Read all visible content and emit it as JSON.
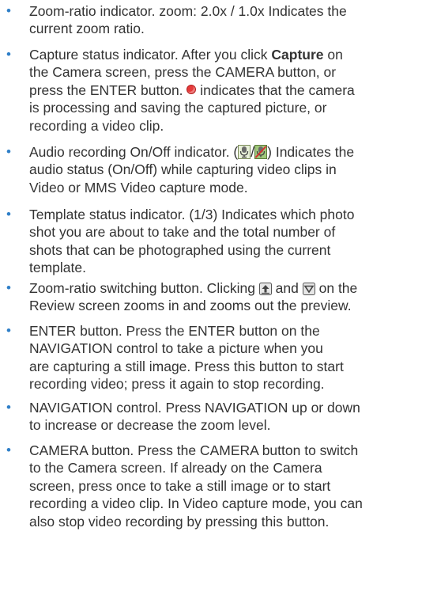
{
  "items": [
    {
      "lines": [
        "Zoom-ratio indicator. zoom: 2.0x / 1.0x Indicates the",
        "current zoom ratio."
      ]
    },
    {
      "l1": "Capture status indicator. After you click ",
      "bold": "Capture",
      "l1b": " on",
      "l2": "the Camera screen, press the CAMERA button, or",
      "l3a": "press the ENTER button. ",
      "l3b": " indicates that the camera",
      "l4": "is processing and saving the captured picture, or",
      "l5": "recording a video clip."
    },
    {
      "l1a": "Audio recording On/Off indicator. (",
      "l1b": "/",
      "l1c": ") Indicates the",
      "l2": "audio status (On/Off) while capturing video clips in",
      "l3": "Video or MMS Video capture mode."
    },
    {
      "lines": [
        "Template status indicator. (1/3) Indicates which photo",
        "shot you are about to take and the total number of",
        "shots that can be photographed using the current",
        "template."
      ]
    },
    {
      "l1a": "Zoom-ratio switching button. Clicking ",
      "l1b": " and ",
      "l1c": " on the",
      "l2": "Review screen zooms in and zooms out the preview."
    },
    {
      "lines": [
        "ENTER button. Press the ENTER button on the",
        "NAVIGATION control to take a picture when you",
        "are capturing a still image. Press this button to start",
        "recording video; press it again to stop recording."
      ]
    },
    {
      "lines": [
        "NAVIGATION control. Press NAVIGATION up or down",
        "to increase or decrease the zoom level."
      ]
    },
    {
      "lines": [
        "CAMERA button. Press the CAMERA button to switch",
        "to the Camera screen. If already on the Camera",
        "screen, press once to take a still image or to start",
        "recording a video clip. In Video capture mode, you can",
        "also stop video recording by pressing this button."
      ]
    }
  ],
  "bullet_char": "•",
  "colors": {
    "text": "#333333",
    "bullet": "#2f7fc8",
    "status_dot": "#e63a3a"
  },
  "icons": [
    "status-dot-icon",
    "microphone-on-icon",
    "microphone-off-icon",
    "zoom-in-icon",
    "zoom-out-icon"
  ]
}
